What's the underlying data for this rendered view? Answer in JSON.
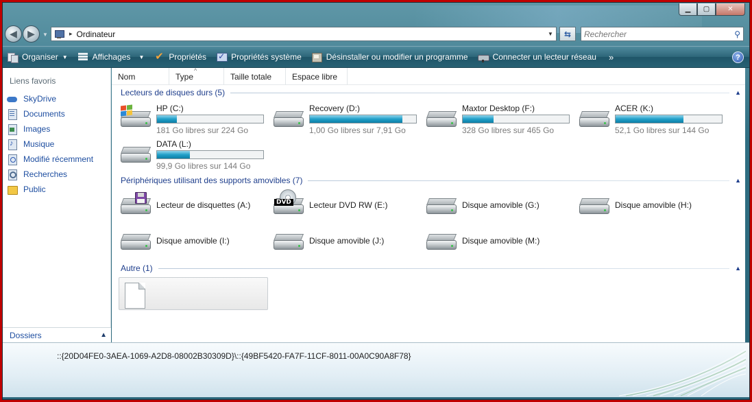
{
  "window": {
    "minimize_label": "▁",
    "maximize_label": "▢",
    "close_label": "✕"
  },
  "address": {
    "path": "Ordinateur",
    "separator": "▸"
  },
  "search": {
    "placeholder": "Rechercher"
  },
  "toolbar": {
    "items": [
      {
        "label": "Organiser",
        "icon": "organize-icon",
        "has_dropdown": true
      },
      {
        "label": "Affichages",
        "icon": "views-icon",
        "has_dropdown": true
      },
      {
        "label": "Propriétés",
        "icon": "properties-check-icon",
        "has_dropdown": false
      },
      {
        "label": "Propriétés système",
        "icon": "system-properties-icon",
        "has_dropdown": false
      },
      {
        "label": "Désinstaller ou modifier un programme",
        "icon": "uninstall-icon",
        "has_dropdown": false
      },
      {
        "label": "Connecter un lecteur réseau",
        "icon": "network-drive-icon",
        "has_dropdown": false
      }
    ],
    "more": "»",
    "help": "?"
  },
  "sidebar": {
    "title": "Liens favoris",
    "items": [
      {
        "label": "SkyDrive",
        "icon": "skydrive-icon"
      },
      {
        "label": "Documents",
        "icon": "documents-icon"
      },
      {
        "label": "Images",
        "icon": "pictures-icon"
      },
      {
        "label": "Musique",
        "icon": "music-icon"
      },
      {
        "label": "Modifié récemment",
        "icon": "recent-icon"
      },
      {
        "label": "Recherches",
        "icon": "searches-icon"
      },
      {
        "label": "Public",
        "icon": "public-folder-icon"
      }
    ],
    "folders_label": "Dossiers"
  },
  "columns": [
    "Nom",
    "Type",
    "Taille totale",
    "Espace libre"
  ],
  "groups": {
    "hard_drives": {
      "title": "Lecteurs de disques durs (5)",
      "items": [
        {
          "name": "HP (C:)",
          "free": "181 Go libres sur 224 Go",
          "used_fraction": 0.19
        },
        {
          "name": "Recovery (D:)",
          "free": "1,00 Go libres sur 7,91 Go",
          "used_fraction": 0.87
        },
        {
          "name": "Maxtor Desktop (F:)",
          "free": "328 Go libres sur 465 Go",
          "used_fraction": 0.29
        },
        {
          "name": "ACER (K:)",
          "free": "52,1 Go libres sur 144 Go",
          "used_fraction": 0.64
        },
        {
          "name": "DATA (L:)",
          "free": "99,9 Go libres sur 144 Go",
          "used_fraction": 0.31
        }
      ]
    },
    "removable": {
      "title": "Périphériques utilisant des supports amovibles (7)",
      "items": [
        {
          "name": "Lecteur de disquettes (A:)",
          "icon": "floppy-drive-icon"
        },
        {
          "name": "Lecteur DVD RW (E:)",
          "icon": "dvd-drive-icon",
          "badge": "DVD"
        },
        {
          "name": "Disque amovible (G:)",
          "icon": "removable-drive-icon"
        },
        {
          "name": "Disque amovible (H:)",
          "icon": "removable-drive-icon"
        },
        {
          "name": "Disque amovible (I:)",
          "icon": "removable-drive-icon"
        },
        {
          "name": "Disque amovible (J:)",
          "icon": "removable-drive-icon"
        },
        {
          "name": "Disque amovible (M:)",
          "icon": "removable-drive-icon"
        }
      ]
    },
    "other": {
      "title": "Autre (1)"
    }
  },
  "details": {
    "path": "::{20D04FE0-3AEA-1069-A2D8-08002B30309D}\\::{49BF5420-FA7F-11CF-8011-00A0C90A8F78}"
  },
  "colors": {
    "accent_link": "#1e4ea0",
    "bar_fill": "#22a0c9",
    "frame": "#c00000"
  }
}
